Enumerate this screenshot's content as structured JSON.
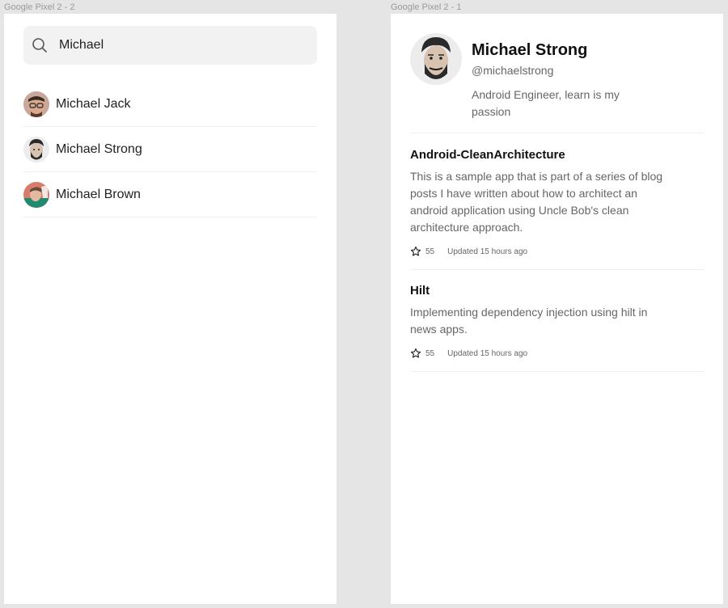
{
  "frames": {
    "search_label": "Google Pixel 2 - 2",
    "profile_label": "Google Pixel 2 - 1"
  },
  "search": {
    "value": "Michael",
    "icon": "search-icon",
    "results": [
      {
        "name": "Michael Jack"
      },
      {
        "name": "Michael Strong"
      },
      {
        "name": "Michael Brown"
      }
    ]
  },
  "profile": {
    "name": "Michael Strong",
    "handle": "@michaelstrong",
    "bio": "Android Engineer, learn is my passion",
    "repos": [
      {
        "title": "Android-CleanArchitecture",
        "description": "This is a sample app that is part of a series of blog posts I have written about how to architect an android application using Uncle Bob's clean architecture approach.",
        "stars": "55",
        "updated": "Updated 15 hours ago"
      },
      {
        "title": "Hilt",
        "description": "Implementing dependency injection using hilt in news apps.",
        "stars": "55",
        "updated": "Updated 15 hours ago"
      }
    ]
  },
  "colors": {
    "canvas": "#e5e5e5",
    "surface": "#ffffff",
    "search_bg": "#f2f2f2",
    "divider": "#efefef",
    "text_primary": "#111111",
    "text_secondary": "#666666"
  }
}
